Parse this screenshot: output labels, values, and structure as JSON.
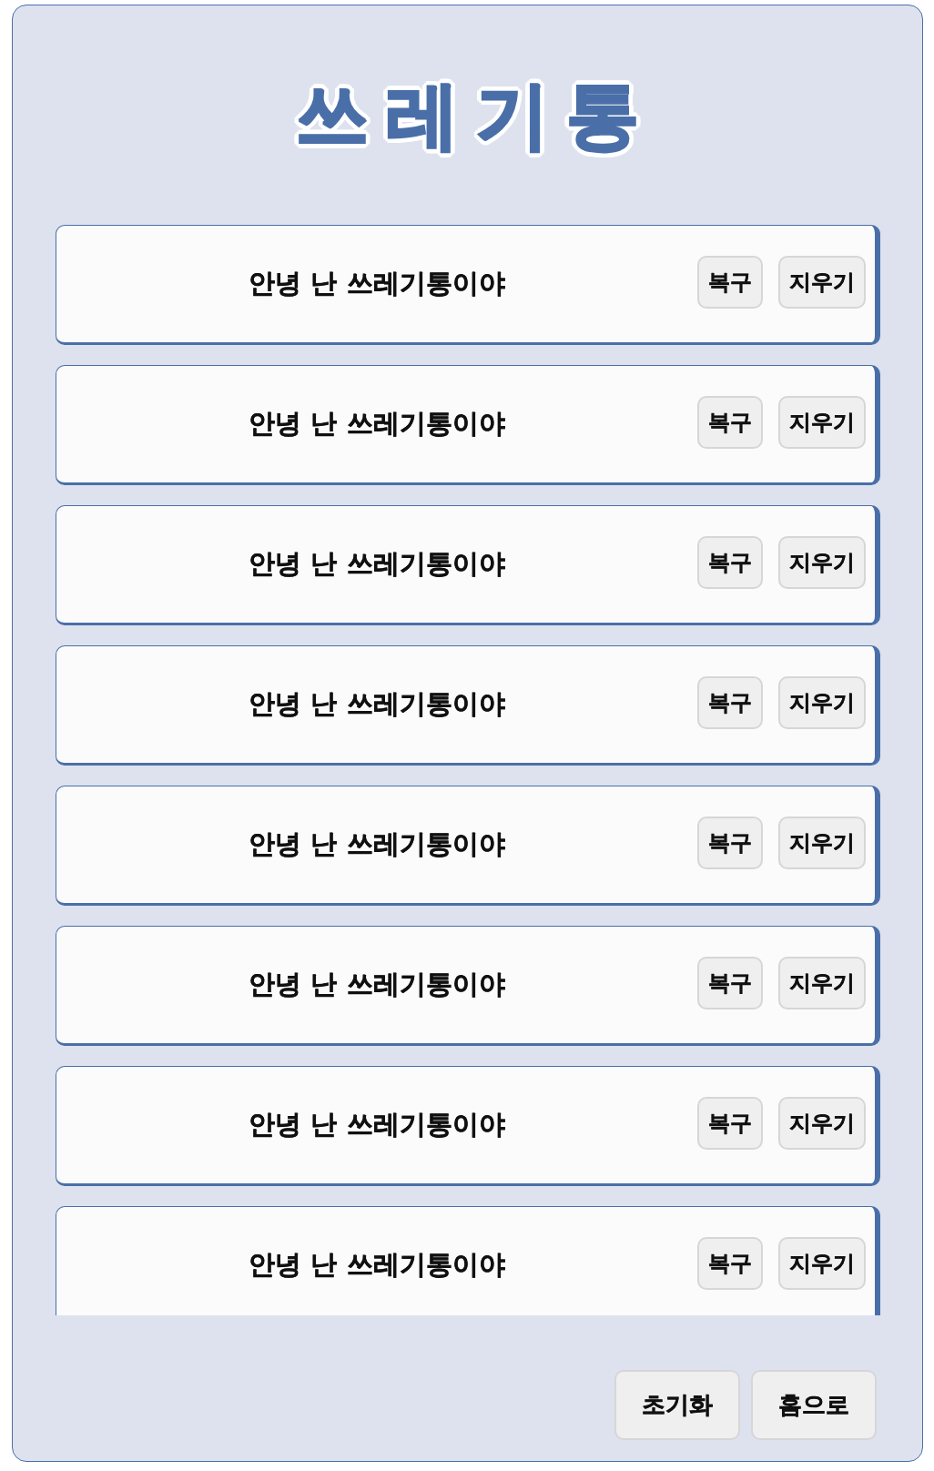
{
  "title": "쓰레기통",
  "items": [
    {
      "message": "안녕 난 쓰레기통이야",
      "buttons": [
        "복구",
        "지우기"
      ]
    },
    {
      "message": "안녕 난 쓰레기통이야",
      "buttons": [
        "복구",
        "지우기"
      ]
    },
    {
      "message": "안녕 난 쓰레기통이야",
      "buttons": [
        "복구",
        "지우기"
      ]
    },
    {
      "message": "안녕 난 쓰레기통이야",
      "buttons": [
        "복구",
        "지우기"
      ]
    },
    {
      "message": "안녕 난 쓰레기통이야",
      "buttons": [
        "복구",
        "지우기"
      ]
    },
    {
      "message": "안녕 난 쓰레기통이야",
      "buttons": [
        "복구",
        "지우기"
      ]
    },
    {
      "message": "안녕 난 쓰레기통이야",
      "buttons": [
        "복구",
        "지우기"
      ]
    },
    {
      "message": "안녕 난 쓰레기통이야",
      "buttons": [
        "복구",
        "지우기"
      ]
    }
  ],
  "actions": [
    "초기화",
    "홈으로"
  ]
}
